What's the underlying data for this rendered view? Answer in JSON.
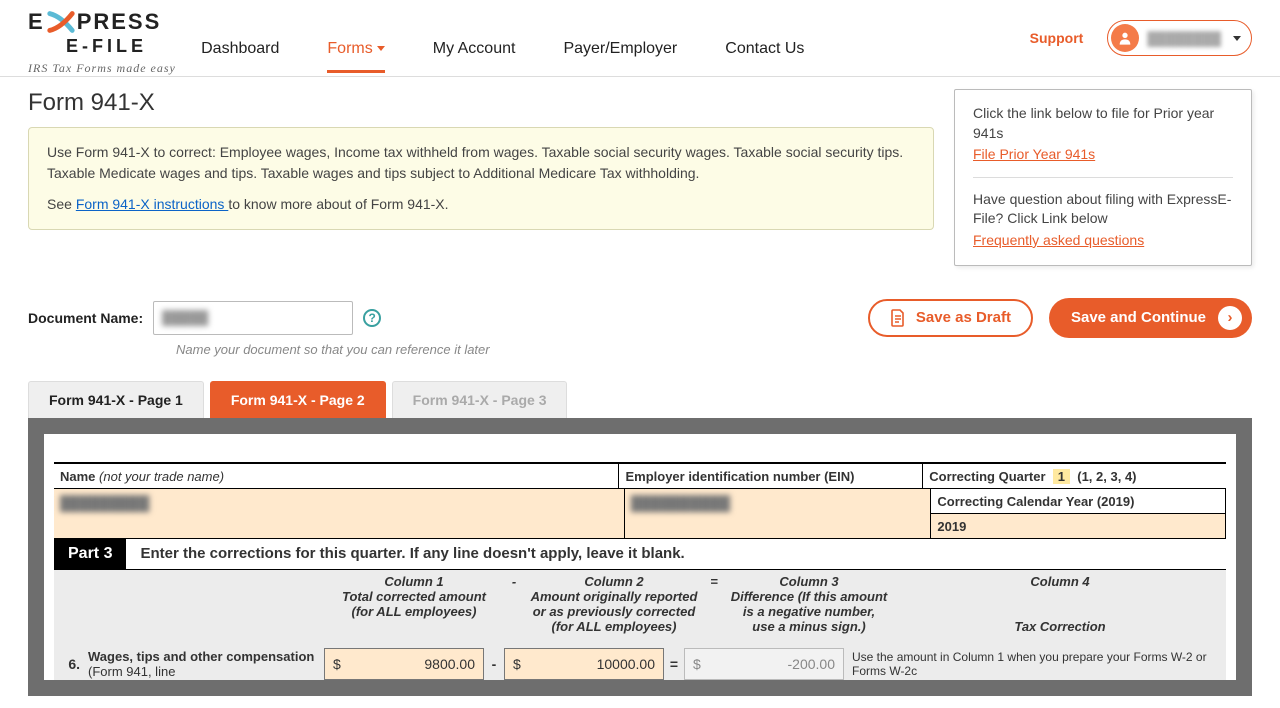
{
  "header": {
    "logo_line1": "E XPRESS",
    "logo_line2": "E-FILE",
    "tagline": "IRS Tax Forms made easy",
    "support": "Support",
    "user_label": "████████"
  },
  "nav": {
    "dashboard": "Dashboard",
    "forms": "Forms",
    "account": "My Account",
    "payer": "Payer/Employer",
    "contact": "Contact Us"
  },
  "page": {
    "title": "Form 941-X",
    "info1": "Use Form 941-X to correct: Employee wages, Income tax withheld from wages. Taxable social security wages. Taxable social security tips. Taxable Medicate wages and tips. Taxable wages and tips subject to Additional Medicare Tax withholding.",
    "info2_pre": "See ",
    "info2_link": "Form 941-X instructions ",
    "info2_post": "to know more about of Form 941-X."
  },
  "side": {
    "p1": "Click the link below to file for Prior year 941s",
    "l1": "File Prior Year 941s",
    "p2": "Have question about filing with ExpressE-File? Click Link below",
    "l2": "Frequently asked questions"
  },
  "doc": {
    "label": "Document Name:",
    "value": "█████",
    "hint": "Name your document so that you can reference it later",
    "help": "?"
  },
  "actions": {
    "draft": "Save as Draft",
    "continue": "Save and Continue"
  },
  "tabs": {
    "t1": "Form 941-X - Page 1",
    "t2": "Form 941-X - Page 2",
    "t3": "Form 941-X - Page 3"
  },
  "form": {
    "name_label": "Name ",
    "name_note": "(not your trade name)",
    "name_value": "█████████",
    "ein_label": "Employer identification number (EIN)",
    "ein_value": "██████████",
    "cq_label": "Correcting Quarter",
    "cq_value": "1",
    "cq_opts": "(1, 2, 3, 4)",
    "cy_label": "Correcting Calendar Year (2019)",
    "cy_value": "2019",
    "part_badge": "Part 3",
    "part_text": "Enter the corrections for this quarter. If any line doesn't apply, leave it blank.",
    "col1_h": "Column 1",
    "col1_s": "Total corrected amount (for ALL employees)",
    "col2_h": "Column 2",
    "col2_s": "Amount originally reported or as previously corrected (for ALL employees)",
    "col3_h": "Column 3",
    "col3_s": "Difference (If this amount is a negative number, use a minus sign.)",
    "col4_h": "Column 4",
    "col4_s": "Tax Correction",
    "line6_num": "6.",
    "line6_a": "Wages, tips and other compensation",
    "line6_b": " (Form 941, line",
    "line6_c1": "9800.00",
    "line6_c2": "10000.00",
    "line6_c3": "-200.00",
    "line6_note": "Use the amount in Column 1 when you prepare your Forms W-2 or Forms W-2c",
    "dollar": "$",
    "minus": "-",
    "equals": "="
  }
}
